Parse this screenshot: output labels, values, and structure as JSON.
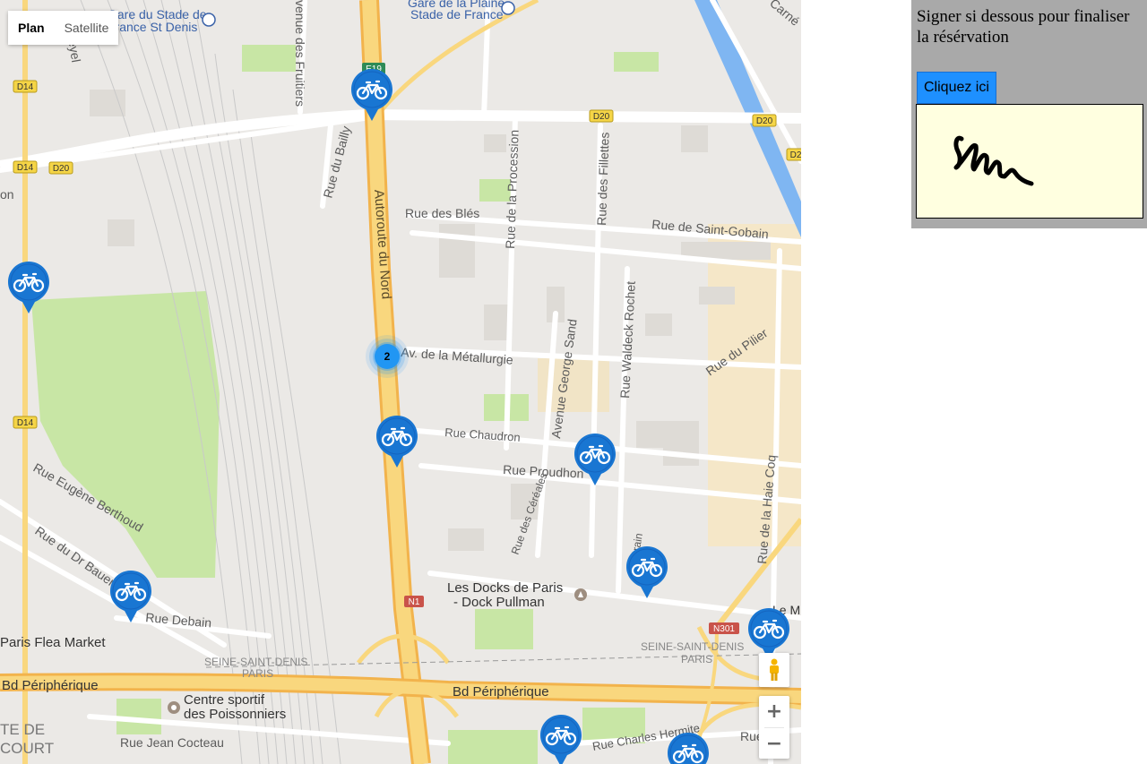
{
  "map": {
    "maptype": {
      "plan": "Plan",
      "satellite": "Satellite"
    },
    "labels": {
      "gare_stade_1": "Gare du Stade de",
      "gare_stade_2": "France St Denis",
      "gare_plaine_1": "Gare de la Plaine",
      "gare_plaine_2": "Stade de France",
      "av_fruitiers": "venue des Fruitiers",
      "carne": "Carné",
      "meyel": "eyel",
      "rue_bailly": "Rue du Bailly",
      "autoroute_nord": "Autoroute du Nord",
      "rue_bles": "Rue des Blés",
      "rue_procession": "Rue de la Procession",
      "rue_fillettes": "Rue des Fillettes",
      "rue_saint_gobain": "Rue de Saint-Gobain",
      "av_metallurgie": "Av. de la Métallurgie",
      "rue_waldeck": "Rue Waldeck Rochet",
      "avenue_george_sand": "Avenue George Sand",
      "rue_pilier": "Rue du Pilier",
      "rue_chaudron": "Rue Chaudron",
      "rue_proudhon": "Rue Proudhon",
      "rue_eugene": "Rue Eugène Berthoud",
      "rue_dr_bauer": "Rue du Dr Bauer",
      "rue_cereales": "Rue des Céréales",
      "rue_haie_coq": "Rue de la Haie Coq",
      "rue_grain": "Grain",
      "les_docks_1": "Les Docks de Paris",
      "les_docks_2": "- Dock Pullman",
      "rue_debain": "Rue Debain",
      "paris_flea": "Paris Flea Market",
      "ssd_left_1": "SEINE-SAINT-DENIS",
      "ssd_left_2": "PARIS",
      "ssd_right_1": "SEINE-SAINT-DENIS",
      "ssd_right_2": "PARIS",
      "bd_periph_left": "Bd Périphérique",
      "bd_periph_right": "Bd Périphérique",
      "centre_sportif_1": "Centre sportif",
      "centre_sportif_2": "des Poissonniers",
      "te_de": "TE DE",
      "court": "COURT",
      "rue_cocteau": "Rue Jean Cocteau",
      "rue_hermite": "Rue Charles Hermite",
      "rue_m": "Rue M",
      "le_m": "Le M",
      "on": "on"
    },
    "shields": {
      "e19": "E19",
      "d14_a": "D14",
      "d14_b": "D14",
      "d14_c": "D14",
      "d20_a": "D20",
      "d20_b": "D20",
      "d20_c": "D20",
      "d2": "D2",
      "n1": "N1",
      "n301": "N301"
    },
    "cluster_count": "2",
    "zoom_in": "+",
    "zoom_out": "−",
    "marker_icon": "bicycle-icon",
    "colors": {
      "marker": "#1976d2",
      "cluster": "#2196f3",
      "highway": "#f9d77e",
      "park": "#c8e6a5",
      "water": "#7fb6f2"
    }
  },
  "panel": {
    "message": "Signer si dessous pour finaliser la résérvation",
    "button_label": "Cliquez ici"
  }
}
